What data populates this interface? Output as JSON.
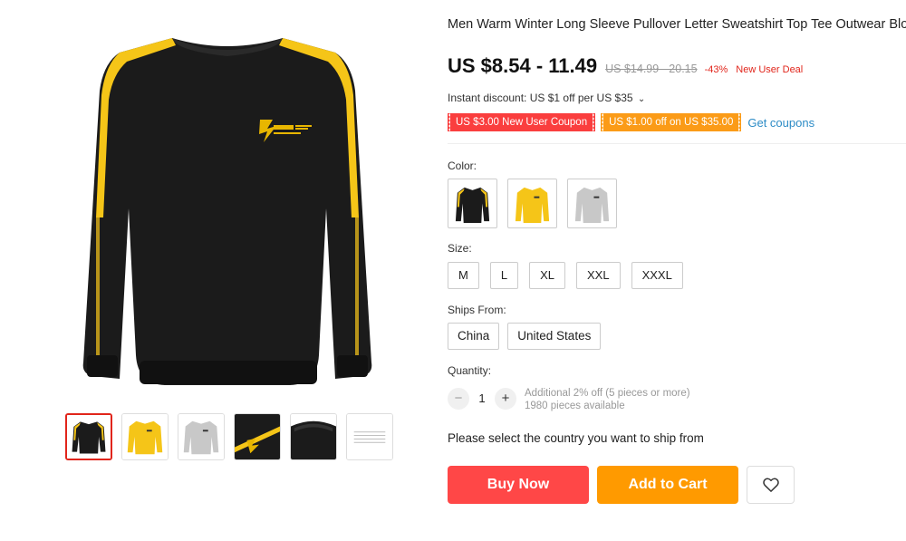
{
  "product": {
    "title": "Men Warm Winter Long Sleeve Pullover Letter Sweatshirt Top Tee Outwear Blouse"
  },
  "price": {
    "current": "US $8.54 - 11.49",
    "original": "US $14.99 - 20.15",
    "discount": "-43%",
    "deal_tag": "New User Deal"
  },
  "instant_discount": {
    "text": "Instant discount: US $1 off per US $35",
    "chevron": "⌄"
  },
  "coupons": {
    "items": [
      {
        "label": "US $3.00 New User Coupon",
        "color": "#fa3e3e"
      },
      {
        "label": "US $1.00 off on US $35.00",
        "color": "#fb9b17"
      }
    ],
    "link": "Get coupons"
  },
  "color": {
    "label": "Color:",
    "options": [
      {
        "name": "black-sweatshirt",
        "fill": "#1b1b1b",
        "accent": "#f5c518"
      },
      {
        "name": "yellow-sweatshirt",
        "fill": "#f5c518",
        "accent": "#e0ad00"
      },
      {
        "name": "gray-sweatshirt",
        "fill": "#c8c8c8",
        "accent": "#b0b0b0"
      }
    ]
  },
  "size": {
    "label": "Size:",
    "options": [
      "M",
      "L",
      "XL",
      "XXL",
      "XXXL"
    ]
  },
  "ships_from": {
    "label": "Ships From:",
    "options": [
      "China",
      "United States"
    ]
  },
  "quantity": {
    "label": "Quantity:",
    "minus": "−",
    "value": "1",
    "plus": "+",
    "note": "Additional 2% off (5 pieces or more)",
    "available": "1980 pieces available"
  },
  "ship_message": "Please select the country you want to ship from",
  "actions": {
    "buy_now": "Buy Now",
    "add_to_cart": "Add to Cart",
    "wishlist_icon": "heart-icon"
  },
  "gallery": {
    "thumbnails": [
      "black-front",
      "yellow-front",
      "gray-front",
      "sleeve-detail",
      "collar-detail",
      "size-chart"
    ],
    "active_index": 0
  },
  "colors": {
    "primary_red": "#ff4747",
    "primary_orange": "#ff9a00",
    "link_blue": "#2d8cc6",
    "sweatshirt_black": "#1b1b1b",
    "stripe_yellow": "#f5c518"
  }
}
